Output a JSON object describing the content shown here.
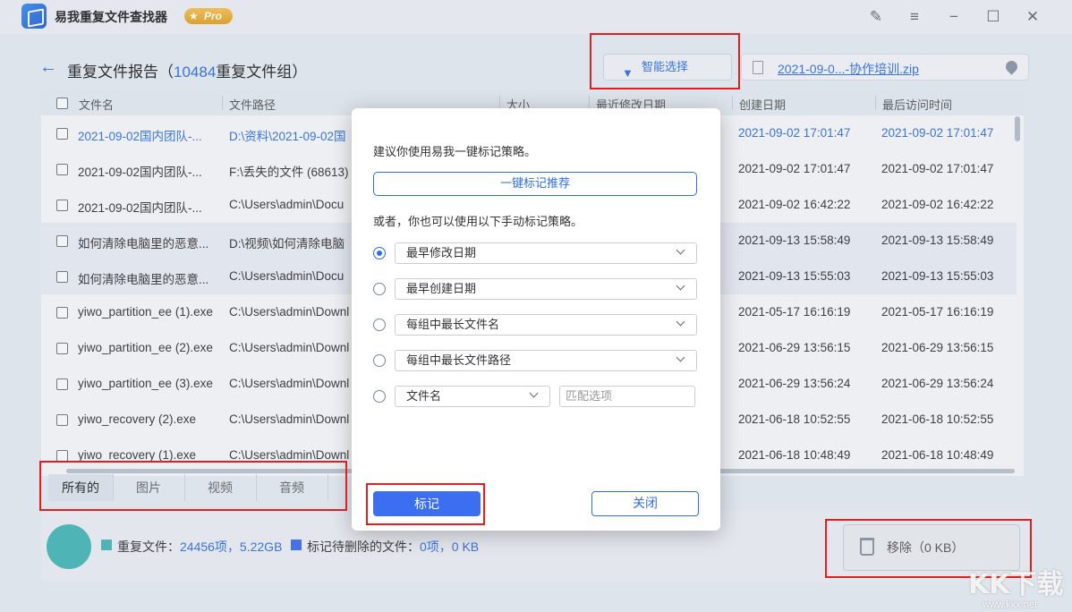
{
  "app": {
    "title": "易我重复文件查找器",
    "badge": "Pro"
  },
  "header": {
    "title_prefix": "重复文件报告（",
    "count": "10484",
    "title_suffix": "重复文件组）",
    "smart_select": "智能选择",
    "current_file": "2021-09-0...-协作培训.zip"
  },
  "table": {
    "columns": [
      "文件名",
      "文件路径",
      "大小",
      "最近修改日期",
      "创建日期",
      "最后访问时间"
    ],
    "rows": [
      {
        "name": "2021-09-02国内团队-...",
        "path": "D:\\资料\\2021-09-02国",
        "created": "2021-09-02 17:01:47",
        "accessed": "2021-09-02 17:01:47"
      },
      {
        "name": "2021-09-02国内团队-...",
        "path": "F:\\丢失的文件 (68613)",
        "created": "2021-09-02 17:01:47",
        "accessed": "2021-09-02 17:01:47"
      },
      {
        "name": "2021-09-02国内团队-...",
        "path": "C:\\Users\\admin\\Docu",
        "created": "2021-09-02 16:42:22",
        "accessed": "2021-09-02 16:42:22"
      },
      {
        "name": "如何清除电脑里的恶意...",
        "path": "D:\\视频\\如何清除电脑",
        "created": "2021-09-13 15:58:49",
        "accessed": "2021-09-13 15:58:49"
      },
      {
        "name": "如何清除电脑里的恶意...",
        "path": "C:\\Users\\admin\\Docu",
        "created": "2021-09-13 15:55:03",
        "accessed": "2021-09-13 15:55:03"
      },
      {
        "name": "yiwo_partition_ee (1).exe",
        "path": "C:\\Users\\admin\\Downl",
        "created": "2021-05-17 16:16:19",
        "accessed": "2021-05-17 16:16:19"
      },
      {
        "name": "yiwo_partition_ee (2).exe",
        "path": "C:\\Users\\admin\\Downl",
        "created": "2021-06-29 13:56:15",
        "accessed": "2021-06-29 13:56:15"
      },
      {
        "name": "yiwo_partition_ee (3).exe",
        "path": "C:\\Users\\admin\\Downl",
        "created": "2021-06-29 13:56:24",
        "accessed": "2021-06-29 13:56:24"
      },
      {
        "name": "yiwo_recovery (2).exe",
        "path": "C:\\Users\\admin\\Downl",
        "created": "2021-06-18 10:52:55",
        "accessed": "2021-06-18 10:52:55"
      },
      {
        "name": "yiwo_recovery (1).exe",
        "path": "C:\\Users\\admin\\Downl",
        "created": "2021-06-18 10:48:49",
        "accessed": "2021-06-18 10:48:49"
      }
    ]
  },
  "tabs": [
    "所有的",
    "图片",
    "视频",
    "音频"
  ],
  "footer": {
    "dup_label": "重复文件：",
    "dup_count": "24456项，5.22GB",
    "mark_label": "标记待删除的文件：",
    "mark_count": "0项，0 KB",
    "remove_button": "移除（0 KB）",
    "colors": {
      "duplicate": "#45b8b8",
      "marked": "#3b6ef0"
    }
  },
  "dialog": {
    "suggest_text": "建议你使用易我一键标记策略。",
    "one_click_button": "一键标记推荐",
    "manual_text": "或者，你也可以使用以下手动标记策略。",
    "options": [
      "最早修改日期",
      "最早创建日期",
      "每组中最长文件名",
      "每组中最长文件路径"
    ],
    "filename_option": "文件名",
    "match_placeholder": "匹配选项",
    "mark_button": "标记",
    "close_button": "关闭"
  },
  "watermark": {
    "main": "KK下载",
    "sub": "www.kkx.net"
  }
}
